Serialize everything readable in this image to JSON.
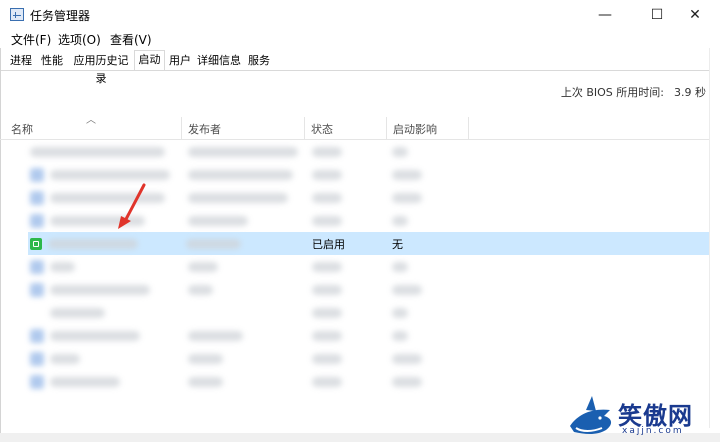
{
  "window": {
    "title": "任务管理器",
    "controls": {
      "minimize": "—",
      "maximize": "☐",
      "close": "✕"
    }
  },
  "menu": [
    {
      "label": "文件(F)"
    },
    {
      "label": "选项(O)"
    },
    {
      "label": "查看(V)"
    }
  ],
  "tabs": [
    {
      "label": "进程",
      "active": false
    },
    {
      "label": "性能",
      "active": false
    },
    {
      "label": "应用历史记录",
      "active": false
    },
    {
      "label": "启动",
      "active": true
    },
    {
      "label": "用户",
      "active": false
    },
    {
      "label": "详细信息",
      "active": false
    },
    {
      "label": "服务",
      "active": false
    }
  ],
  "bios": {
    "label": "上次 BIOS 所用时间:",
    "value": "3.9 秒"
  },
  "columns": {
    "name": "名称",
    "publisher": "发布者",
    "status": "状态",
    "impact": "启动影响"
  },
  "selected_row": {
    "status": "已启用",
    "impact": "无",
    "icon": "app-icon-green"
  },
  "watermark": {
    "main": "笑傲网",
    "sub": "xajjn.com"
  }
}
